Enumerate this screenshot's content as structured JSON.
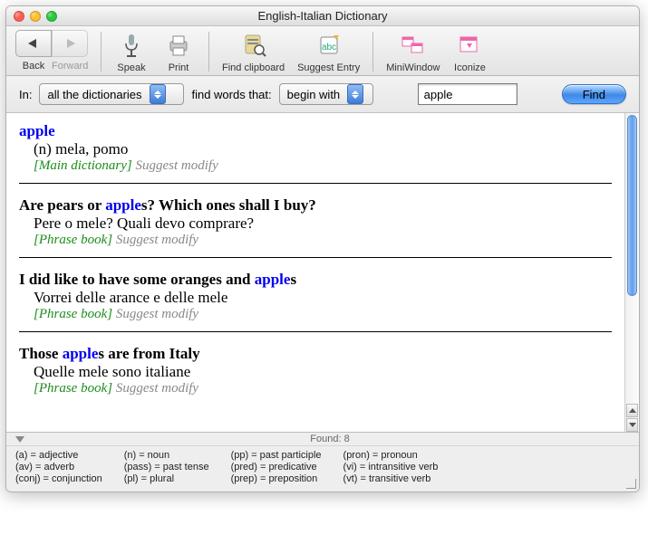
{
  "window": {
    "title": "English-Italian Dictionary"
  },
  "toolbar": {
    "back": "Back",
    "forward": "Forward",
    "speak": "Speak",
    "print": "Print",
    "find_clipboard": "Find clipboard",
    "suggest_entry": "Suggest Entry",
    "miniwindow": "MiniWindow",
    "iconize": "Iconize"
  },
  "search": {
    "in_label": "In:",
    "in_value": "all the dictionaries",
    "match_label": "find words that:",
    "match_value": "begin with",
    "query": "apple",
    "find_label": "Find"
  },
  "results": [
    {
      "head_pre": "",
      "head_kw": "apple",
      "head_post": "",
      "body": "(n) mela, pomo",
      "source": "[Main dictionary]",
      "suggest": "Suggest modify"
    },
    {
      "head_pre": "Are pears or ",
      "head_kw": "apple",
      "head_post": "s? Which ones shall I buy?",
      "body": "Pere o mele? Quali devo comprare?",
      "source": "[Phrase book]",
      "suggest": "Suggest modify"
    },
    {
      "head_pre": "I did like to have some oranges and ",
      "head_kw": "apple",
      "head_post": "s",
      "body": "Vorrei delle arance e delle mele",
      "source": "[Phrase book]",
      "suggest": "Suggest modify"
    },
    {
      "head_pre": "Those ",
      "head_kw": "apple",
      "head_post": "s are from Italy",
      "body": "Quelle mele sono italiane",
      "source": "[Phrase book]",
      "suggest": "Suggest modify"
    }
  ],
  "footer": {
    "found": "Found: 8",
    "legend": [
      [
        "(a) = adjective",
        "(av) = adverb",
        "(conj) = conjunction"
      ],
      [
        "(n) = noun",
        "(pass) = past tense",
        "(pl) = plural"
      ],
      [
        "(pp) = past participle",
        "(pred) = predicative",
        "(prep) = preposition"
      ],
      [
        "(pron) = pronoun",
        "(vi) = intransitive verb",
        "(vt) = transitive verb"
      ]
    ]
  }
}
